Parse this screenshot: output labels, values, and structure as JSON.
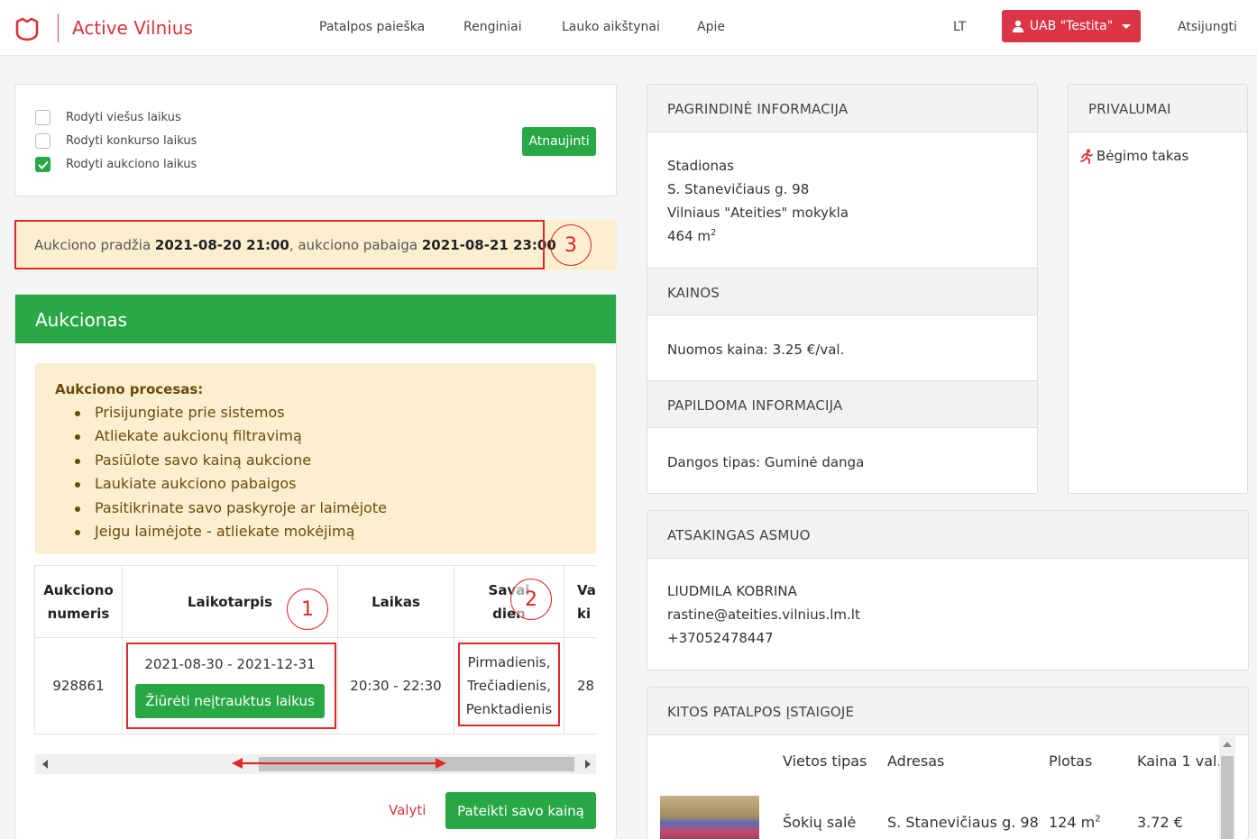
{
  "nav": {
    "brand": "Active Vilnius",
    "items": [
      "Patalpos paieška",
      "Renginiai",
      "Lauko aikštynai",
      "Apie"
    ],
    "lang": "LT",
    "user": "UAB \"Testita\"",
    "logout": "Atsijungti"
  },
  "filters": {
    "options": [
      {
        "label": "Rodyti viešus laikus",
        "checked": false
      },
      {
        "label": "Rodyti konkurso laikus",
        "checked": false
      },
      {
        "label": "Rodyti aukciono laikus",
        "checked": true
      }
    ],
    "refresh": "Atnaujinti"
  },
  "auction_dates": {
    "prefix": "Aukciono pradžia ",
    "start": "2021-08-20 21:00",
    "mid": ", aukciono pabaiga ",
    "end": "2021-08-21 23:00"
  },
  "annotations": [
    "1",
    "2",
    "3"
  ],
  "auction": {
    "title": "Aukcionas",
    "process_title": "Aukciono procesas:",
    "process_steps": [
      "Prisijungiate prie sistemos",
      "Atliekate aukcionų filtravimą",
      "Pasiūlote savo kainą aukcione",
      "Laukiate aukciono pabaigos",
      "Pasitikrinate savo paskyroje ar laimėjote",
      "Jeigu laimėjote - atliekate mokėjimą"
    ],
    "table": {
      "headers": {
        "number_l1": "Aukciono",
        "number_l2": "numeris",
        "period": "Laikotarpis",
        "time": "Laikas",
        "days_l1": "Savai",
        "days_l2": "dien",
        "price_l1": "Va",
        "price_l2": "ki"
      },
      "row": {
        "number": "928861",
        "period": "2021-08-30 - 2021-12-31",
        "view_btn": "Žiūrėti neįtrauktus laikus",
        "time": "20:30 - 22:30",
        "days": [
          "Pirmadienis,",
          "Trečiadienis,",
          "Penktadienis"
        ],
        "price": "28"
      }
    },
    "clear": "Valyti",
    "submit": "Pateikti savo kainą"
  },
  "info": {
    "main_head": "PAGRINDINĖ INFORMACIJA",
    "type": "Stadionas",
    "address": "S. Stanevičiaus g. 98",
    "school": "Vilniaus \"Ateities\" mokykla",
    "area": "464 m",
    "area_sup": "2",
    "prices_head": "KAINOS",
    "rent": "Nuomos kaina: 3.25 €/val.",
    "extra_head": "PAPILDOMA INFORMACIJA",
    "surface": "Dangos tipas: Guminė danga"
  },
  "benefits": {
    "head": "PRIVALUMAI",
    "item": "Bėgimo takas"
  },
  "contact": {
    "head": "ATSAKINGAS ASMUO",
    "name": "LIUDMILA KOBRINA",
    "email": "rastine@ateities.vilnius.lm.lt",
    "phone": "+37052478447"
  },
  "other": {
    "head": "KITOS PATALPOS ĮSTAIGOJE",
    "cols": [
      "Vietos tipas",
      "Adresas",
      "Plotas",
      "Kaina 1 val."
    ],
    "row": {
      "type": "Šokių salė",
      "address": "S. Stanevičiaus g. 98",
      "area": "124 m",
      "area_sup": "2",
      "price": "3.72 €"
    }
  },
  "colors": {
    "brand_red": "#d9343c",
    "green": "#28a745",
    "annotation_red": "#e02828",
    "notice_bg": "#fcefd0"
  }
}
